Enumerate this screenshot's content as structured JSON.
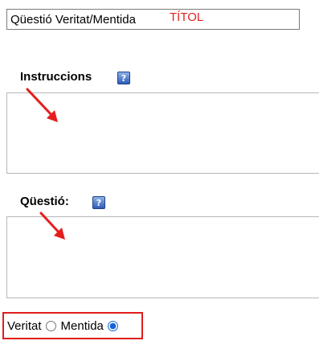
{
  "title": {
    "value": "Qüestió Veritat/Mentida",
    "annotation": "TÍTOL"
  },
  "instructions": {
    "label": "Instruccions",
    "help_icon": "help-icon",
    "help_glyph": "?",
    "value": ""
  },
  "question": {
    "label": "Qüestió:",
    "help_icon": "help-icon",
    "help_glyph": "?",
    "value": ""
  },
  "answer": {
    "options": [
      {
        "label": "Veritat",
        "selected": false
      },
      {
        "label": "Mentida",
        "selected": true
      }
    ]
  },
  "colors": {
    "annotation": "#e32020",
    "highlight_border": "#e01d1d",
    "help_icon": "#2c5cb8",
    "radio_selected": "#1565d8"
  }
}
